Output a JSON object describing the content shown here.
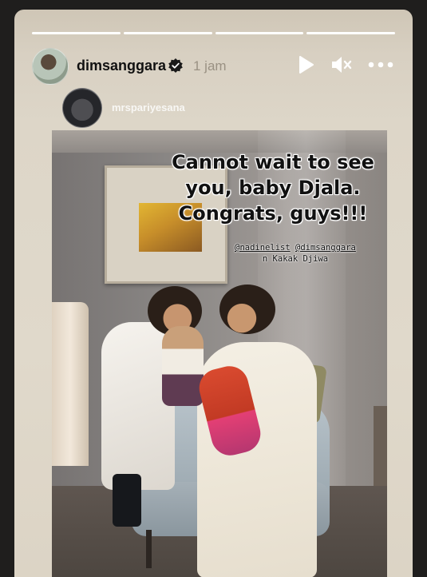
{
  "story": {
    "progress_segments": 4,
    "progress_completed": 4,
    "header": {
      "username": "dimsanggara",
      "verified": true,
      "time": "1 jam",
      "controls": [
        "play-icon",
        "mute-icon",
        "more-icon"
      ]
    },
    "repost": {
      "username": "mrspariyesana"
    },
    "caption": {
      "text": "Cannot wait to see\nyou, baby Djala.\nCongrats, guys!!!",
      "mentions": [
        "@nadinelist",
        "@dimsanggara"
      ],
      "tag_suffix": "n Kakak Djiwa"
    }
  },
  "colors": {
    "background": "#1f1e1d",
    "text": "#111111",
    "timestamp": "#9a9183"
  }
}
